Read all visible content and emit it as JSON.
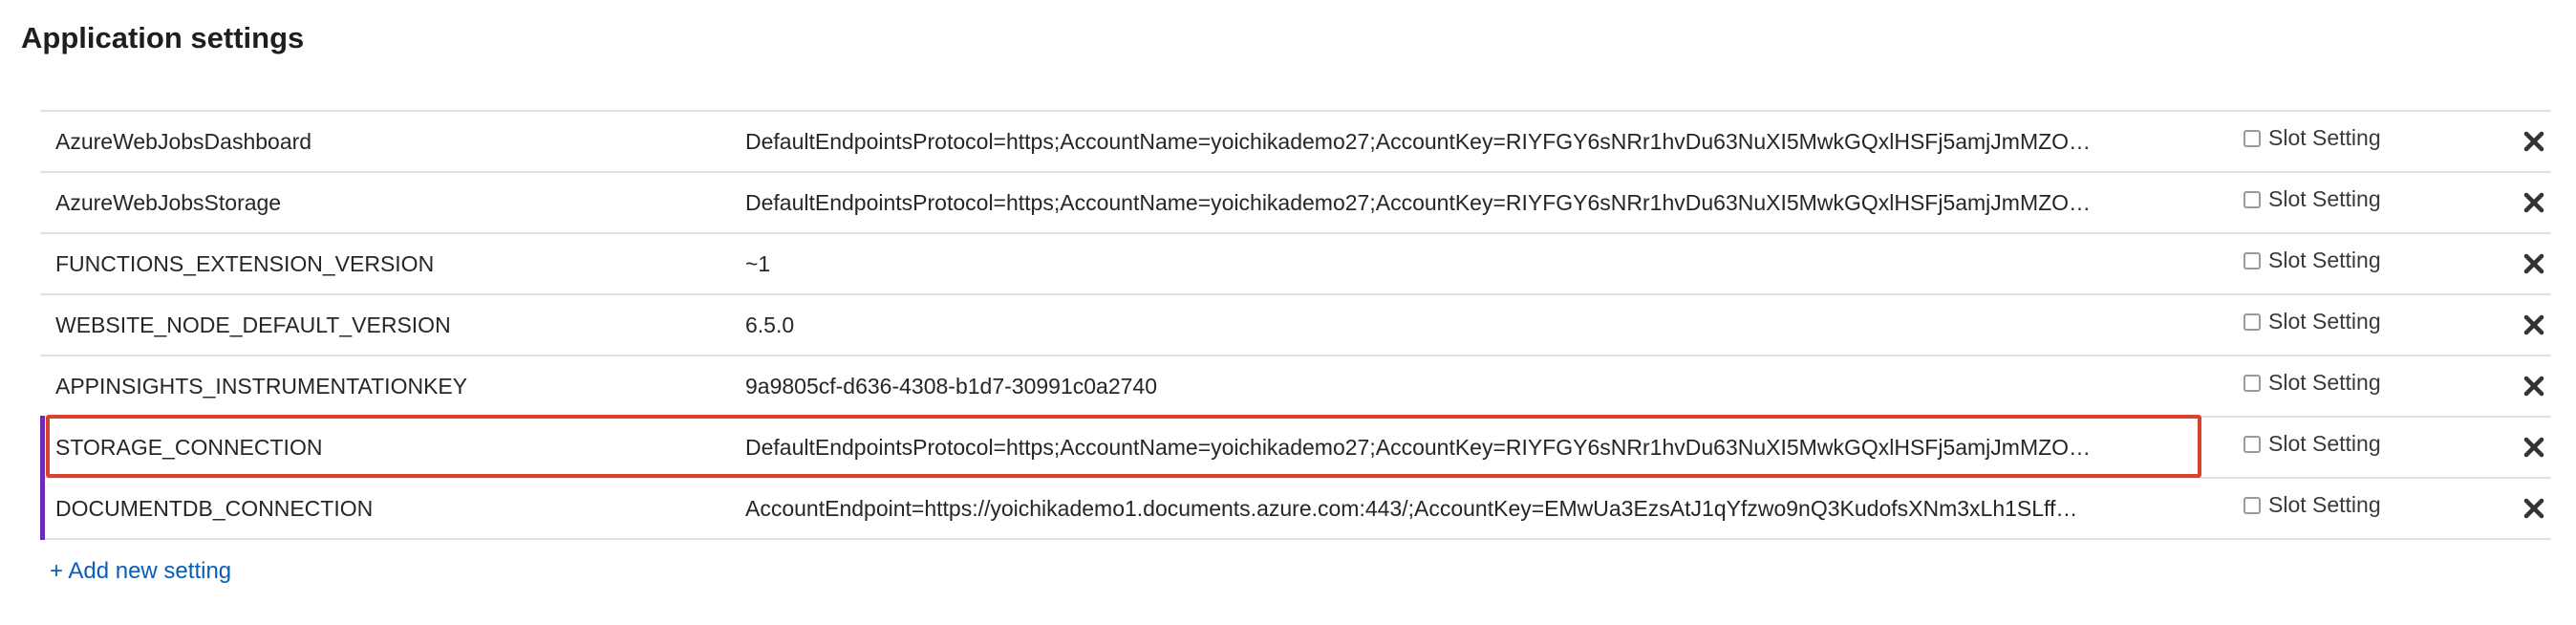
{
  "section": {
    "title": "Application settings"
  },
  "settings": [
    {
      "name": "AzureWebJobsDashboard",
      "value": "DefaultEndpointsProtocol=https;AccountName=yoichikademo27;AccountKey=RIYFGY6sNRr1hvDu63NuXI5MwkGQxlHSFj5amjJmMZO…",
      "slot_label": "Slot Setting",
      "slot_checked": false
    },
    {
      "name": "AzureWebJobsStorage",
      "value": "DefaultEndpointsProtocol=https;AccountName=yoichikademo27;AccountKey=RIYFGY6sNRr1hvDu63NuXI5MwkGQxlHSFj5amjJmMZO…",
      "slot_label": "Slot Setting",
      "slot_checked": false
    },
    {
      "name": "FUNCTIONS_EXTENSION_VERSION",
      "value": "~1",
      "slot_label": "Slot Setting",
      "slot_checked": false
    },
    {
      "name": "WEBSITE_NODE_DEFAULT_VERSION",
      "value": "6.5.0",
      "slot_label": "Slot Setting",
      "slot_checked": false
    },
    {
      "name": "APPINSIGHTS_INSTRUMENTATIONKEY",
      "value": "9a9805cf-d636-4308-b1d7-30991c0a2740",
      "slot_label": "Slot Setting",
      "slot_checked": false
    },
    {
      "name": "STORAGE_CONNECTION",
      "value": "DefaultEndpointsProtocol=https;AccountName=yoichikademo27;AccountKey=RIYFGY6sNRr1hvDu63NuXI5MwkGQxlHSFj5amjJmMZO…",
      "slot_label": "Slot Setting",
      "slot_checked": false
    },
    {
      "name": "DOCUMENTDB_CONNECTION",
      "value": "AccountEndpoint=https://yoichikademo1.documents.azure.com:443/;AccountKey=EMwUa3EzsAtJ1qYfzwo9nQ3KudofsXNm3xLh1SLff…",
      "slot_label": "Slot Setting",
      "slot_checked": false
    }
  ],
  "actions": {
    "add_label": "+ Add new setting"
  },
  "icons": {
    "delete": "close-icon"
  },
  "colors": {
    "highlight": "#d8412f",
    "link": "#0a5db8",
    "modified_marker": "#6d2bb8"
  }
}
